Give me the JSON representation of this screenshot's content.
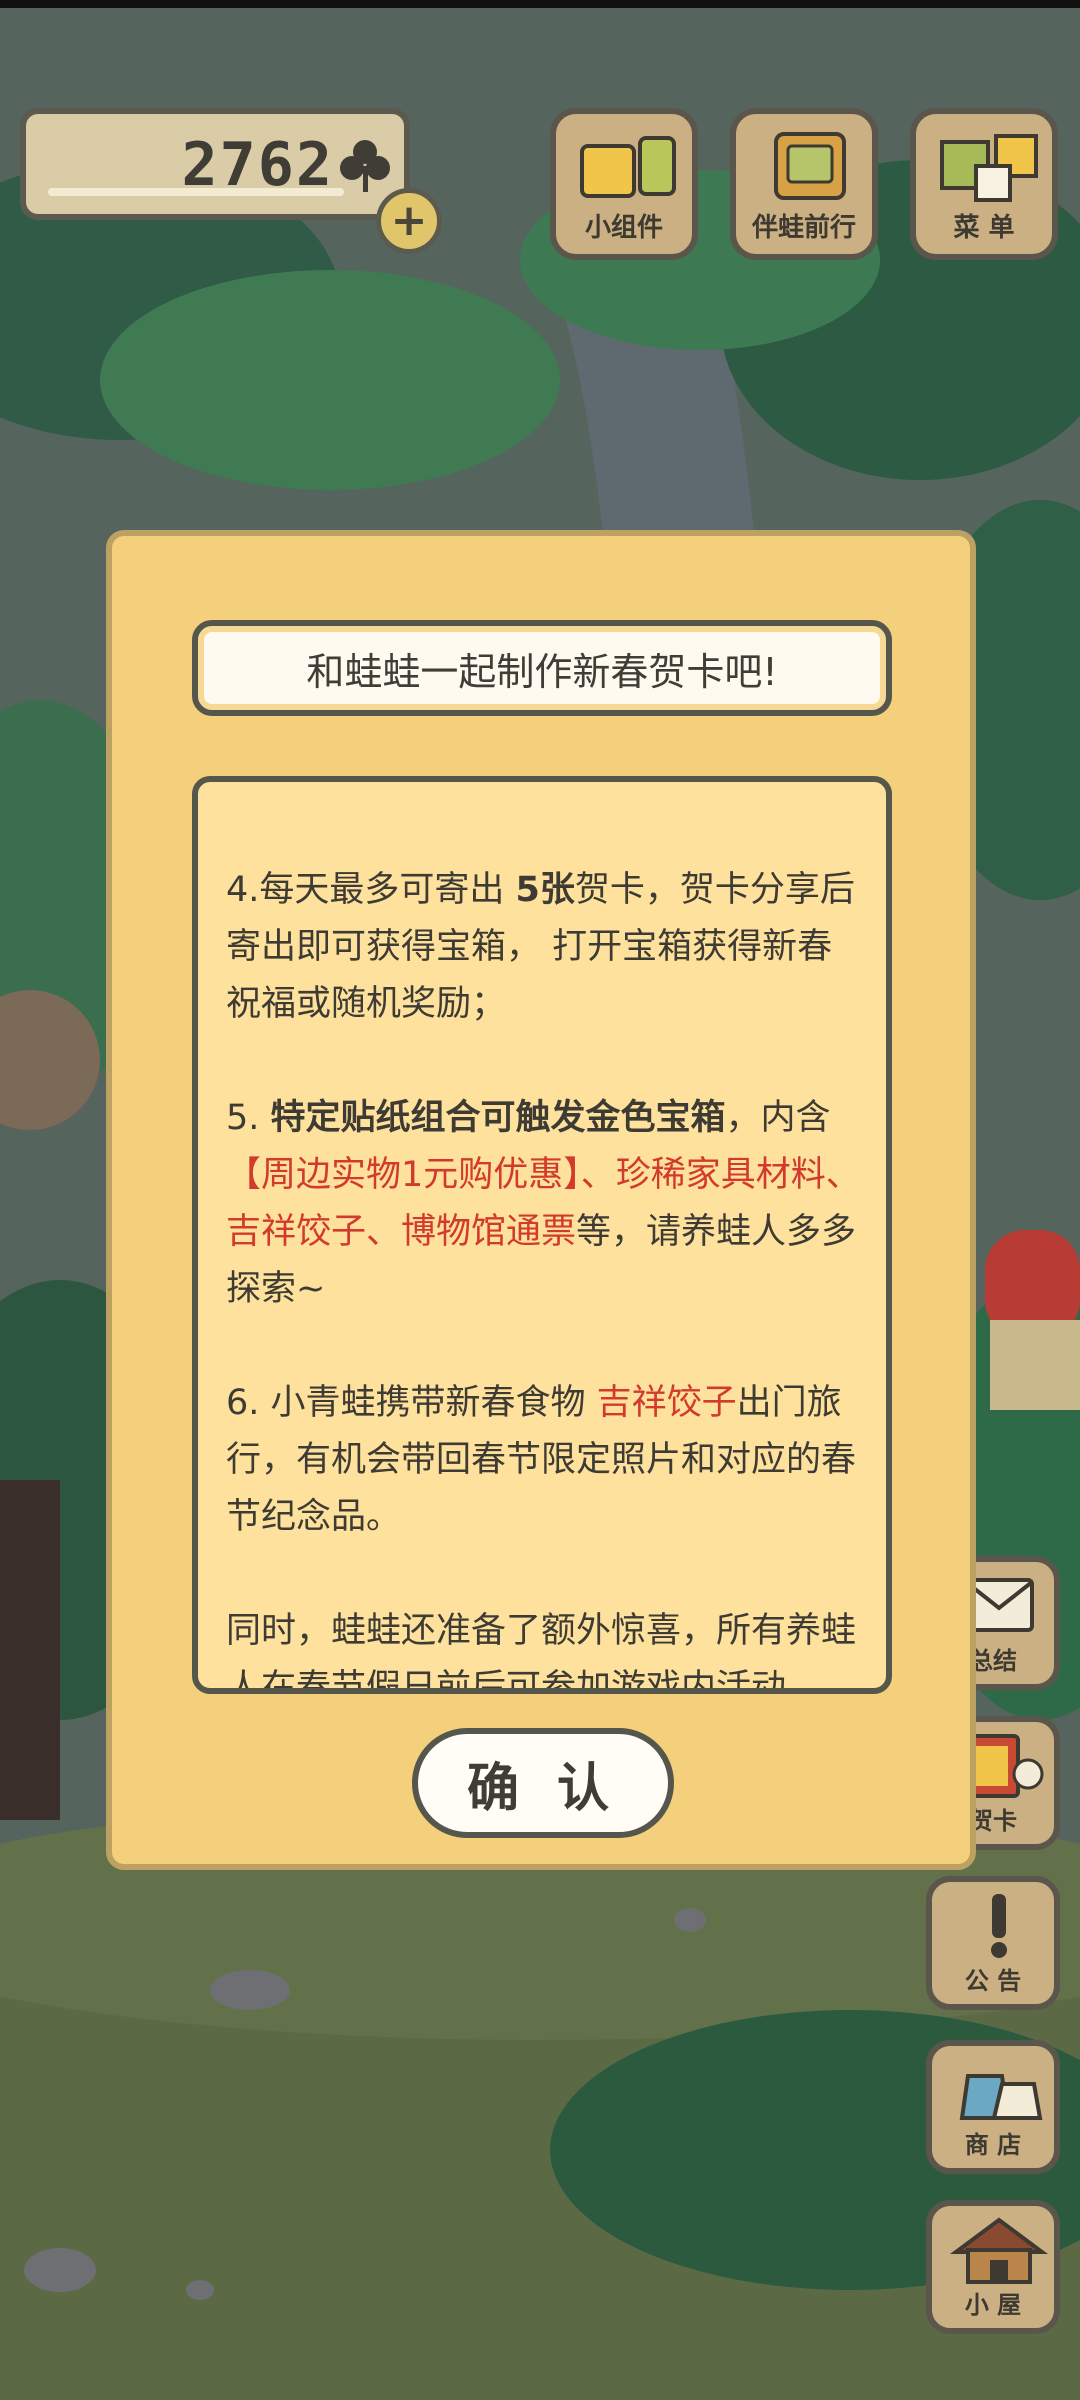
{
  "header": {
    "clover_count": "2762",
    "add_symbol": "+",
    "buttons": [
      {
        "label": "小组件",
        "icon": "widget-icon"
      },
      {
        "label": "伴蛙前行",
        "icon": "journey-icon"
      },
      {
        "label": "菜 单",
        "icon": "menu-icon"
      }
    ]
  },
  "side_buttons": [
    {
      "label": "总结",
      "icon": "letter-icon"
    },
    {
      "label": "贺卡",
      "icon": "greeting-card-icon"
    },
    {
      "label": "公 告",
      "icon": "notice-icon"
    },
    {
      "label": "商 店",
      "icon": "shop-icon"
    },
    {
      "label": "小 屋",
      "icon": "house-icon"
    }
  ],
  "dialog": {
    "title": "和蛙蛙一起制作新春贺卡吧!",
    "confirm_label": "确 认",
    "items": {
      "p4_a": "4.每天最多可寄出 ",
      "p4_b": "5张",
      "p4_c": "贺卡，贺卡分享后寄出即可获得宝箱， 打开宝箱获得新春祝福或随机奖励；",
      "p5_a": "5. ",
      "p5_b": "特定贴纸组合可触发金色宝箱",
      "p5_c": "，内含",
      "p5_d": "【周边实物1元购优惠】、珍稀家具材料、吉祥饺子、博物馆通票",
      "p5_e": "等，请养蛙人多多探索~",
      "p6_a": "6. 小青蛙携带新春食物 ",
      "p6_b": "吉祥饺子",
      "p6_c": "出门旅行，有机会带回春节限定照片和对应的春节纪念品。",
      "p7_a": "同时，蛙蛙还准备了额外惊喜，所有养蛙人在春节假日前后可参加游戏内活动"
    }
  },
  "colors": {
    "dialog_bg": "#f4cf7c",
    "body_bg": "#fee19c",
    "highlight_red": "#d13a2d",
    "button_wood": "#cbb083"
  }
}
